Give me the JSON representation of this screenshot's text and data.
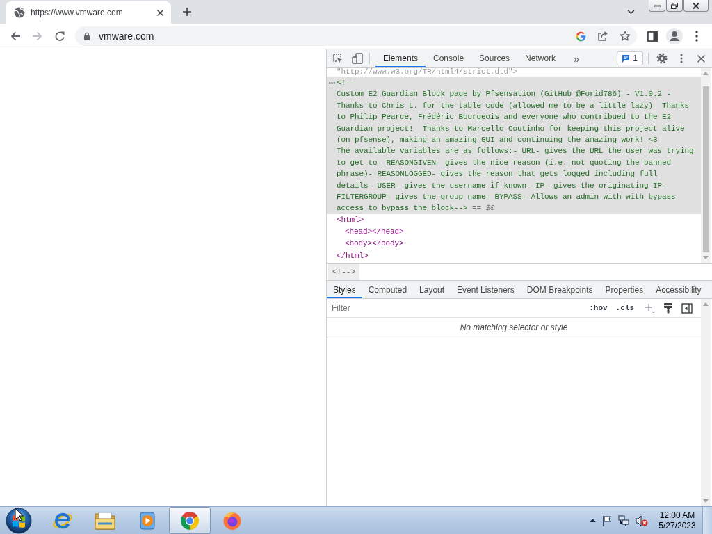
{
  "browser": {
    "tabs": [
      {
        "title": "https://www.vmware.com",
        "selected": true
      }
    ],
    "nav_buttons": [
      {
        "kind": "back",
        "disabled": false
      },
      {
        "kind": "forward",
        "disabled": true
      },
      {
        "kind": "reload",
        "disabled": false
      }
    ],
    "address": "vmware.com"
  },
  "devtools": {
    "tabs": [
      {
        "label": "Elements",
        "selected": true
      },
      {
        "label": "Console",
        "selected": false
      },
      {
        "label": "Sources",
        "selected": false
      },
      {
        "label": "Network",
        "selected": false
      }
    ],
    "more_tabs": "»",
    "issues_count": "1",
    "elements": {
      "doctype_tail": "\"http://www.w3.org/TR/html4/strict.dtd\">",
      "comment": {
        "selected": true,
        "lines": [
          "<!--",
          "Custom E2 Guardian Block page by Pfsensation (GitHub @Forid786) - V1.0.2 -",
          "Thanks to Chris L. for the table code (allowed me to be a little lazy)- Thanks",
          "to Philip Pearce, Frédéric Bourgeois and everyone who contribued to the E2",
          "Guardian project!- Thanks to Marcello Coutinho for keeping this project alive",
          "(on pfsense), making an amazing GUI and continuing the amazing work! <3",
          "The available variables are as follows:- URL- gives the URL the user was trying",
          "to get to- REASONGIVEN- gives the nice reason (i.e. not quoting the banned",
          "phrase)- REASONLOGGED- gives the reason that gets logged including full",
          "details- USER- gives the username if known- IP- gives the originating IP-",
          "FILTERGROUP- gives the group name- BYPASS- Allows an admin with with bypass",
          "access to bypass the block-->"
        ],
        "marker": "== $0"
      },
      "nodes": [
        {
          "tag": "<html>",
          "closing": "</html>",
          "children": [
            {
              "tag": "<head></head>"
            },
            {
              "tag": "<body></body>"
            }
          ]
        }
      ]
    },
    "breadcrumbs": [
      {
        "label": "<!-->",
        "selected": true
      }
    ],
    "sidebar_tabs": [
      {
        "label": "Styles",
        "selected": true
      },
      {
        "label": "Computed",
        "selected": false
      },
      {
        "label": "Layout",
        "selected": false
      },
      {
        "label": "Event Listeners",
        "selected": false
      },
      {
        "label": "DOM Breakpoints",
        "selected": false
      },
      {
        "label": "Properties",
        "selected": false
      },
      {
        "label": "Accessibility",
        "selected": false
      }
    ],
    "filter": {
      "placeholder": "Filter"
    },
    "filter_buttons": [
      ":hov",
      ".cls"
    ],
    "empty_message": "No matching selector or style"
  },
  "taskbar": {
    "apps": [
      {
        "kind": "internet-explorer",
        "selected": false
      },
      {
        "kind": "file-explorer",
        "selected": false
      },
      {
        "kind": "media-player",
        "selected": false
      },
      {
        "kind": "chrome",
        "selected": true
      },
      {
        "kind": "firefox",
        "selected": false
      }
    ],
    "clock": {
      "time": "12:00 AM",
      "date": "5/27/2023"
    }
  }
}
